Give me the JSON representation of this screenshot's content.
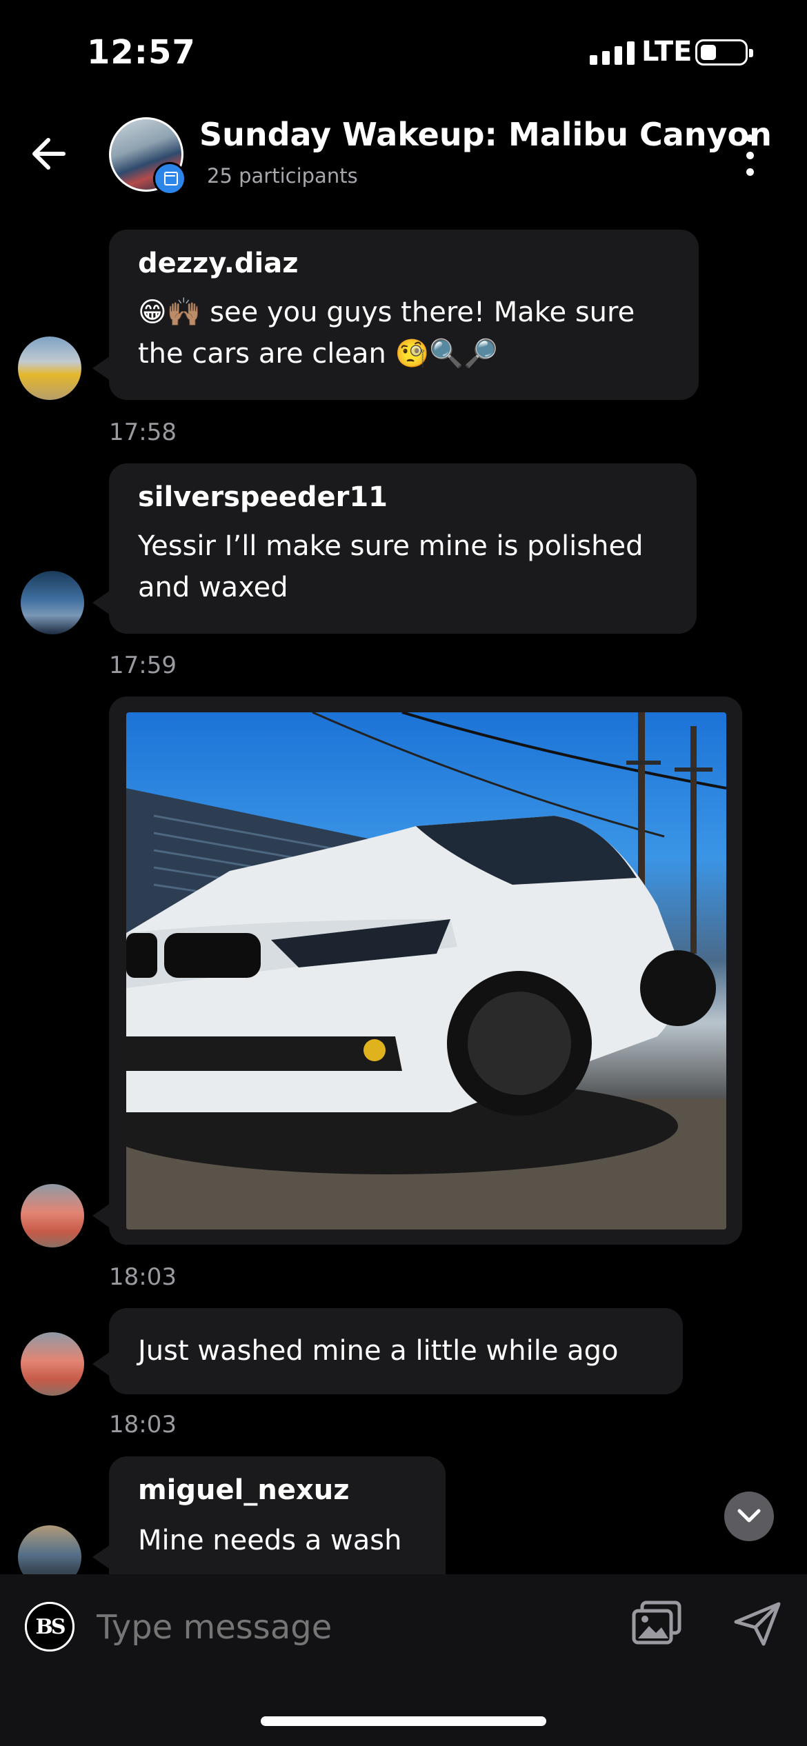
{
  "status_bar": {
    "time": "12:57",
    "network": "LTE"
  },
  "header": {
    "title": "Sunday Wakeup: Malibu Canyon",
    "participants": "25 participants",
    "back_icon": "arrow-left-icon",
    "menu_icon": "kebab-vertical-icon",
    "badge_icon": "calendar-icon"
  },
  "messages": [
    {
      "sender": "dezzy.diaz",
      "text_line1": "😁🙌🏽 see you guys there! Make sure",
      "text_line2": "the cars are clean 🧐🔍🔎",
      "time": "17:58"
    },
    {
      "sender": "silverspeeder11",
      "text_line1": "Yessir I’ll make sure mine is polished",
      "text_line2": "and waxed",
      "time": "17:59"
    },
    {
      "type": "image",
      "time": "18:03"
    },
    {
      "text": "Just washed mine a little while ago",
      "time": "18:03"
    },
    {
      "sender": "miguel_nexuz",
      "text": "Mine needs a wash"
    }
  ],
  "composer": {
    "placeholder": "Type message",
    "logo_text": "BS",
    "image_icon": "image-gallery-icon",
    "send_icon": "send-paper-plane-icon"
  },
  "colors": {
    "background": "#000000",
    "bubble": "#1a1a1c",
    "accent": "#2c86ea"
  }
}
